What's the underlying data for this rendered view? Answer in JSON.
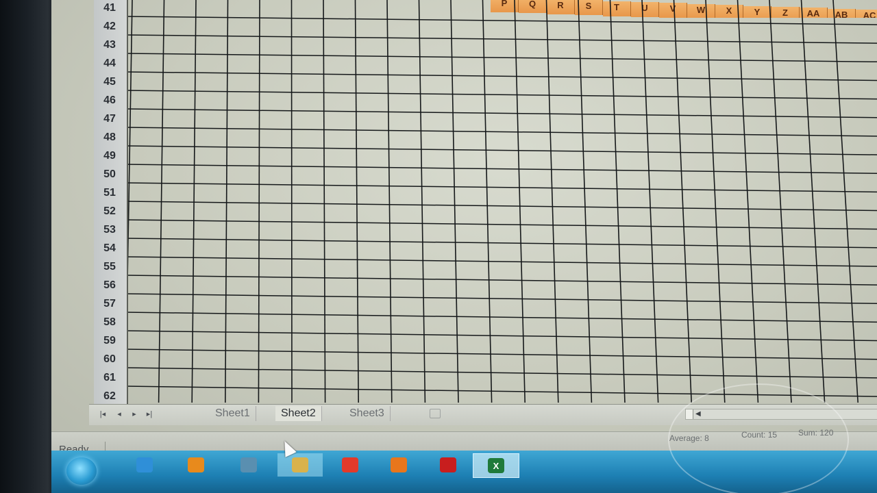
{
  "columns": [
    "P",
    "Q",
    "R",
    "S",
    "T",
    "U",
    "V",
    "W",
    "X",
    "Y",
    "Z",
    "AA",
    "AB",
    "AC"
  ],
  "rows": [
    "41",
    "42",
    "43",
    "44",
    "45",
    "46",
    "47",
    "48",
    "49",
    "50",
    "51",
    "52",
    "53",
    "54",
    "55",
    "56",
    "57",
    "58",
    "59",
    "60",
    "61",
    "62"
  ],
  "sheet_tabs": [
    {
      "label": "Sheet1",
      "active": false
    },
    {
      "label": "Sheet2",
      "active": true
    },
    {
      "label": "Sheet3",
      "active": false
    }
  ],
  "status_bar": {
    "ready": "Ready",
    "average": "Average: 8",
    "count": "Count: 15",
    "sum": "Sum: 120"
  },
  "taskbar": {
    "items": [
      {
        "icon": "internet-explorer-icon",
        "color": "#2f8fd8"
      },
      {
        "icon": "media-player-icon",
        "color": "#e88a1c"
      },
      {
        "icon": "video-editor-icon",
        "color": "#5a8fb0"
      },
      {
        "icon": "file-explorer-icon",
        "color": "#d9b24c"
      },
      {
        "icon": "app-red-icon",
        "color": "#e23a2a"
      },
      {
        "icon": "firefox-icon",
        "color": "#e8761c"
      },
      {
        "icon": "adobe-reader-icon",
        "color": "#c81e1e"
      },
      {
        "icon": "excel-icon",
        "color": "#1f7a3a",
        "glyph": "X"
      }
    ]
  },
  "colors": {
    "header_selected": "#e8974a",
    "grid_line": "#15181a",
    "taskbar": "#1d7fb3"
  }
}
